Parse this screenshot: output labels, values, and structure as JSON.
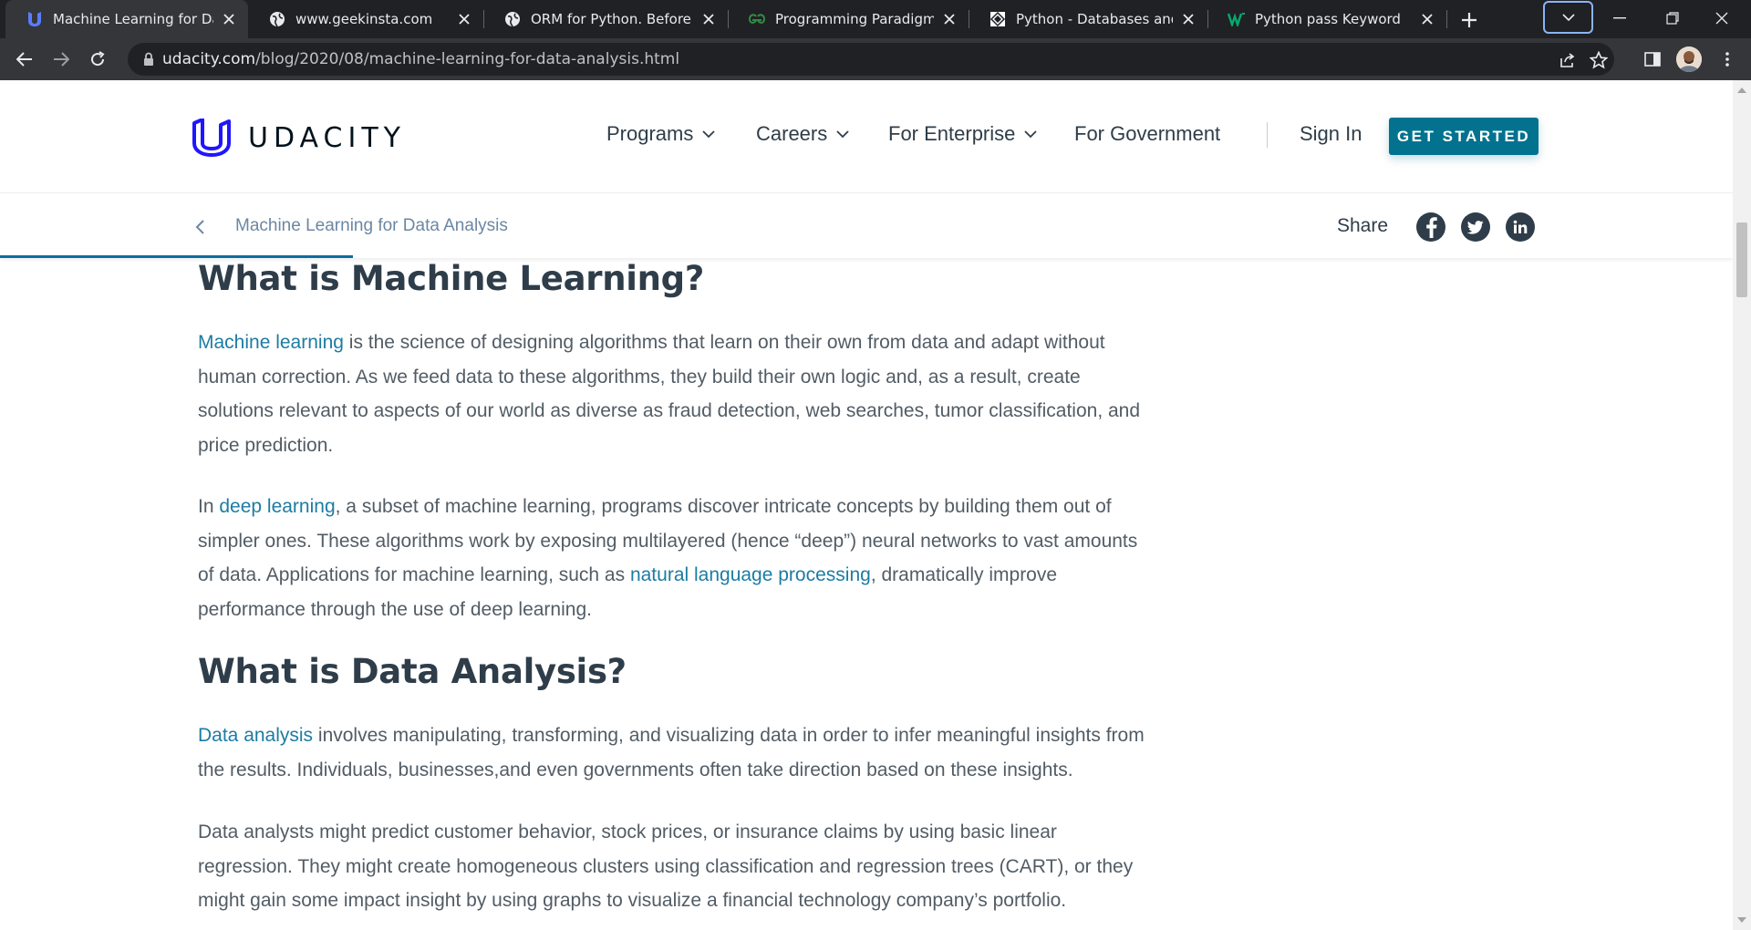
{
  "browser": {
    "tabs": [
      {
        "title": "Machine Learning for Data Analysis | Udacity",
        "active": true,
        "favicon": "udacity-icon"
      },
      {
        "title": "www.geekinsta.com",
        "active": false,
        "favicon": "globe-icon"
      },
      {
        "title": "ORM for Python. Before giving an ...",
        "active": false,
        "favicon": "globe-icon"
      },
      {
        "title": "Programming Paradigms in Python",
        "active": false,
        "favicon": "geeksforgeeks-icon"
      },
      {
        "title": "Python - Databases and SQL",
        "active": false,
        "favicon": "tutorialspoint-icon"
      },
      {
        "title": "Python pass Keyword",
        "active": false,
        "favicon": "w3schools-icon"
      }
    ],
    "url_host": "udacity.com",
    "url_path": "/blog/2020/08/machine-learning-for-data-analysis.html"
  },
  "header": {
    "logo_text": "UDACITY",
    "nav": [
      {
        "label": "Programs",
        "dropdown": true
      },
      {
        "label": "Careers",
        "dropdown": true
      },
      {
        "label": "For Enterprise",
        "dropdown": true
      },
      {
        "label": "For Government",
        "dropdown": false
      }
    ],
    "sign_in": "Sign In",
    "cta": "GET STARTED"
  },
  "subbar": {
    "breadcrumb": "Machine Learning for Data Analysis",
    "share_label": "Share",
    "reading_progress": 0.2
  },
  "article": {
    "h_ml": "What is Machine Learning?",
    "p1_link": "Machine learning",
    "p1_rest": " is the science of designing algorithms that learn on their own from data and adapt without human correction. As we feed data to these algorithms, they build their own logic and, as a result, create solutions relevant to aspects of our world as diverse as fraud detection, web searches, tumor classification, and price prediction.",
    "p2_pre": "In ",
    "p2_link1": "deep learning",
    "p2_mid": ", a subset of machine learning, programs discover intricate concepts by building them out of simpler ones. These algorithms work by exposing multilayered (hence “deep”) neural networks to vast amounts of data. Applications for machine learning, such as ",
    "p2_link2": "natural language processing",
    "p2_post": ", dramatically improve performance through the use of deep learning.",
    "h_da": "What is Data Analysis?",
    "p3_link": "Data analysis",
    "p3_rest": " involves manipulating, transforming, and visualizing data in order to infer meaningful insights from the results. Individuals, businesses,and even governments often take direction based on these insights.",
    "p4": "Data analysts might predict customer behavior, stock prices, or insurance claims by using basic linear regression. They might create homogeneous clusters using classification and regression trees (CART), or they might gain some impact insight by using graphs to visualize a financial technology company’s portfolio."
  },
  "colors": {
    "brand": "#02728f",
    "link": "#1c7ca3",
    "heading": "#2e3d49",
    "body_text": "#525c65"
  }
}
